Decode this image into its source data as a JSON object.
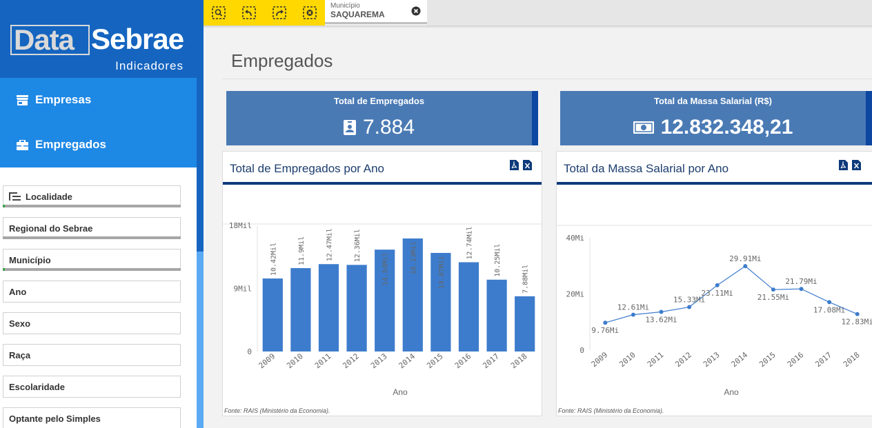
{
  "brand": {
    "logo_data": "Data",
    "logo_sebrae": "Sebrae",
    "subtitle": "Indicadores"
  },
  "menu": {
    "items": [
      {
        "label": "Empresas",
        "icon": "store-icon"
      },
      {
        "label": "Empregados",
        "icon": "briefcase-icon"
      }
    ]
  },
  "filters": [
    {
      "label": "Localidade",
      "icon": "hierarchy-icon",
      "selected": true
    },
    {
      "label": "Regional do Sebrae",
      "selected": false
    },
    {
      "label": "Município",
      "selected": true
    },
    {
      "label": "Ano",
      "selected": false
    },
    {
      "label": "Sexo",
      "selected": false
    },
    {
      "label": "Raça",
      "selected": false
    },
    {
      "label": "Escolaridade",
      "selected": false
    },
    {
      "label": "Optante pelo Simples",
      "selected": false
    }
  ],
  "toolbar": {
    "icons": [
      "smart-search-icon",
      "step-back-icon",
      "step-forward-icon",
      "clear-selections-icon"
    ]
  },
  "selection": {
    "field": "Município",
    "value": "SAQUAREMA"
  },
  "page": {
    "title": "Empregados"
  },
  "kpis": [
    {
      "title": "Total de Empregados",
      "value": "7.884",
      "icon": "id-badge-icon"
    },
    {
      "title": "Total da Massa Salarial (R$)",
      "value": "12.832.348,21",
      "icon": "money-icon"
    }
  ],
  "colors": {
    "brand": "#1565c0",
    "menu": "#1e88e5",
    "toolbar": "#ffd800",
    "kpi": "#4a7ab4",
    "bar": "#3d7ccc",
    "line": "#3d7ccc"
  },
  "panels": [
    {
      "title": "Total de Empregados por Ano",
      "source": "Fonte: RAIS (Ministério da Economia)."
    },
    {
      "title": "Total da Massa Salarial por Ano",
      "source": "Fonte: RAIS (Ministério da Economia)."
    }
  ],
  "chart_data": [
    {
      "type": "bar",
      "title": "Total de Empregados por Ano",
      "xlabel": "Ano",
      "ylabel": "",
      "categories": [
        "2009",
        "2010",
        "2011",
        "2012",
        "2013",
        "2014",
        "2015",
        "2016",
        "2017",
        "2018"
      ],
      "values": [
        10420,
        11900,
        12470,
        12360,
        14540,
        16130,
        14070,
        12740,
        10250,
        7880
      ],
      "labels": [
        "10.42Mil",
        "11.9Mil",
        "12.47Mil",
        "12.36Mil",
        "14.54Mil",
        "16.13Mil",
        "14.07Mil",
        "12.74Mil",
        "10.25Mil",
        "7.88Mil"
      ],
      "ylim": [
        0,
        18000
      ],
      "yticks": [
        {
          "value": 0,
          "label": "0"
        },
        {
          "value": 9000,
          "label": "9Mil"
        },
        {
          "value": 18000,
          "label": "18Mil"
        }
      ],
      "grid": false
    },
    {
      "type": "line",
      "title": "Total da Massa Salarial por Ano",
      "xlabel": "Ano",
      "ylabel": "",
      "categories": [
        "2009",
        "2010",
        "2011",
        "2012",
        "2013",
        "2014",
        "2015",
        "2016",
        "2017",
        "2018"
      ],
      "values": [
        9.76,
        12.61,
        13.62,
        15.33,
        23.11,
        29.91,
        21.55,
        21.79,
        17.08,
        12.83
      ],
      "labels": [
        "9.76Mi",
        "12.61Mi",
        "13.62Mi",
        "15.33Mi",
        "23.11Mi",
        "29.91Mi",
        "21.55Mi",
        "21.79Mi",
        "17.08Mi",
        "12.83Mi"
      ],
      "ylim": [
        0,
        40
      ],
      "yticks": [
        {
          "value": 0,
          "label": "0"
        },
        {
          "value": 20,
          "label": "20Mi"
        },
        {
          "value": 40,
          "label": "40Mi"
        }
      ],
      "grid": false
    }
  ]
}
